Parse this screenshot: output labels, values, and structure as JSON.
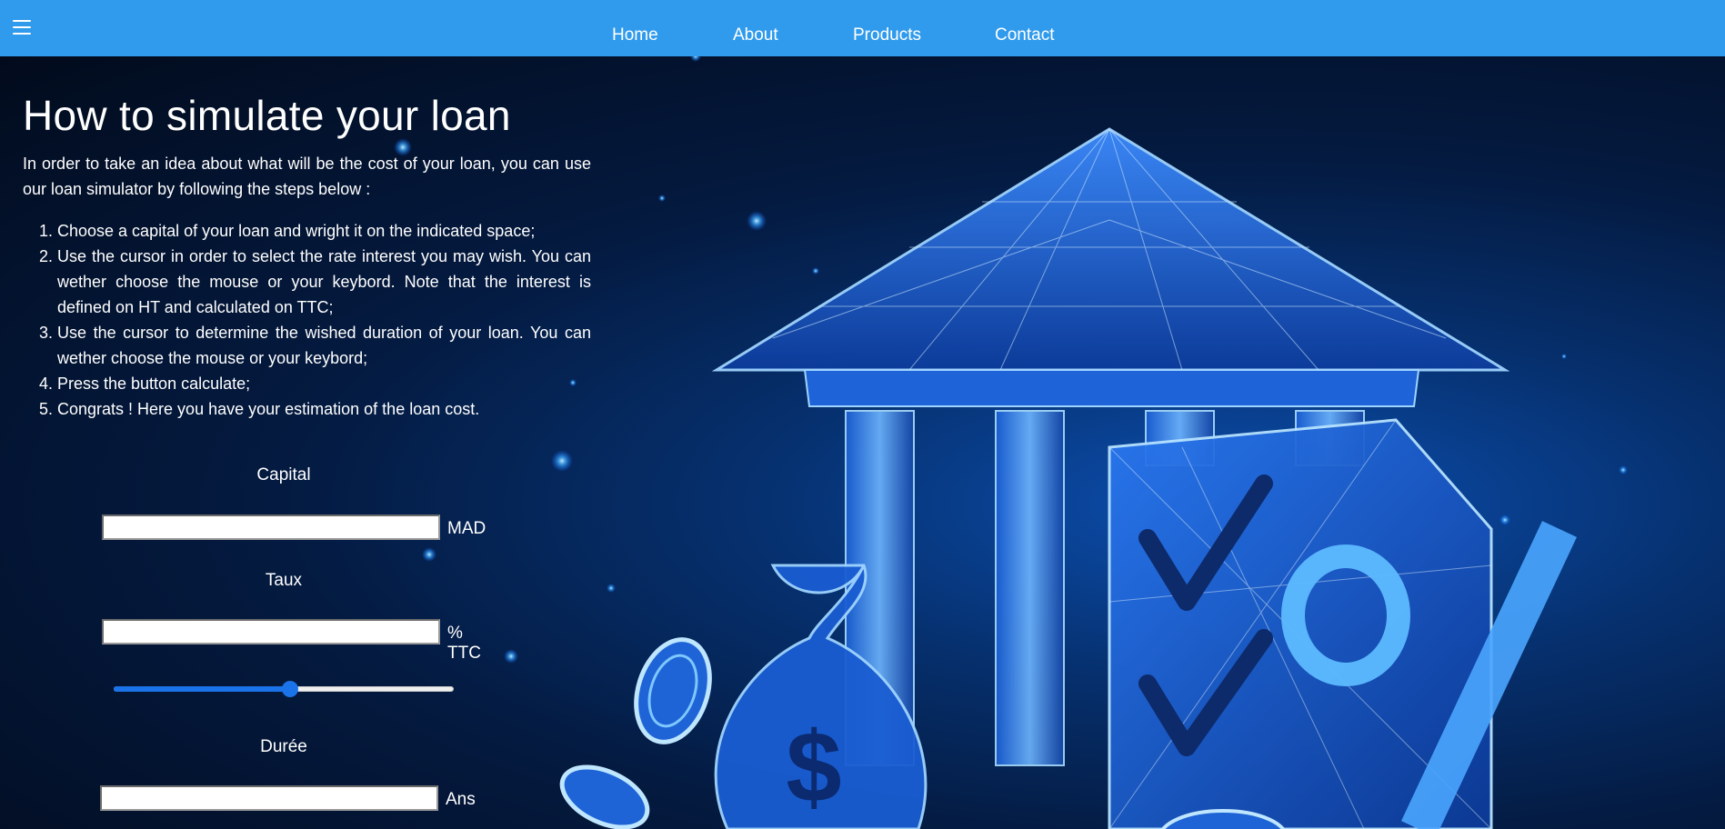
{
  "nav": {
    "menu_icon": "hamburger-menu-icon",
    "links": [
      "Home",
      "About",
      "Products",
      "Contact"
    ]
  },
  "main": {
    "title": "How to simulate your loan",
    "intro": "In order to take an idea about what will be the cost of your loan, you can use our loan simulator by following the steps below :",
    "steps": [
      "Choose a capital of your loan and wright it on the indicated space;",
      "Use the cursor in order to select the rate interest you may wish. You can wether choose the mouse or your keybord. Note that the interest is defined on HT and calculated on TTC;",
      "Use the cursor to determine the wished duration of your loan. You can wether choose the mouse or your keybord;",
      "Press the button calculate;",
      "Congrats ! Here you have your estimation of the loan cost."
    ]
  },
  "form": {
    "capital": {
      "label": "Capital",
      "value": "",
      "unit": "MAD"
    },
    "taux": {
      "label": "Taux",
      "value": "",
      "unit": "% TTC",
      "slider_fraction": 0.5
    },
    "duree": {
      "label": "Durée",
      "value": "",
      "unit": "Ans"
    }
  },
  "colors": {
    "navbar": "#309bec",
    "slider_accent": "#1a73e8",
    "background": "#04122a"
  }
}
